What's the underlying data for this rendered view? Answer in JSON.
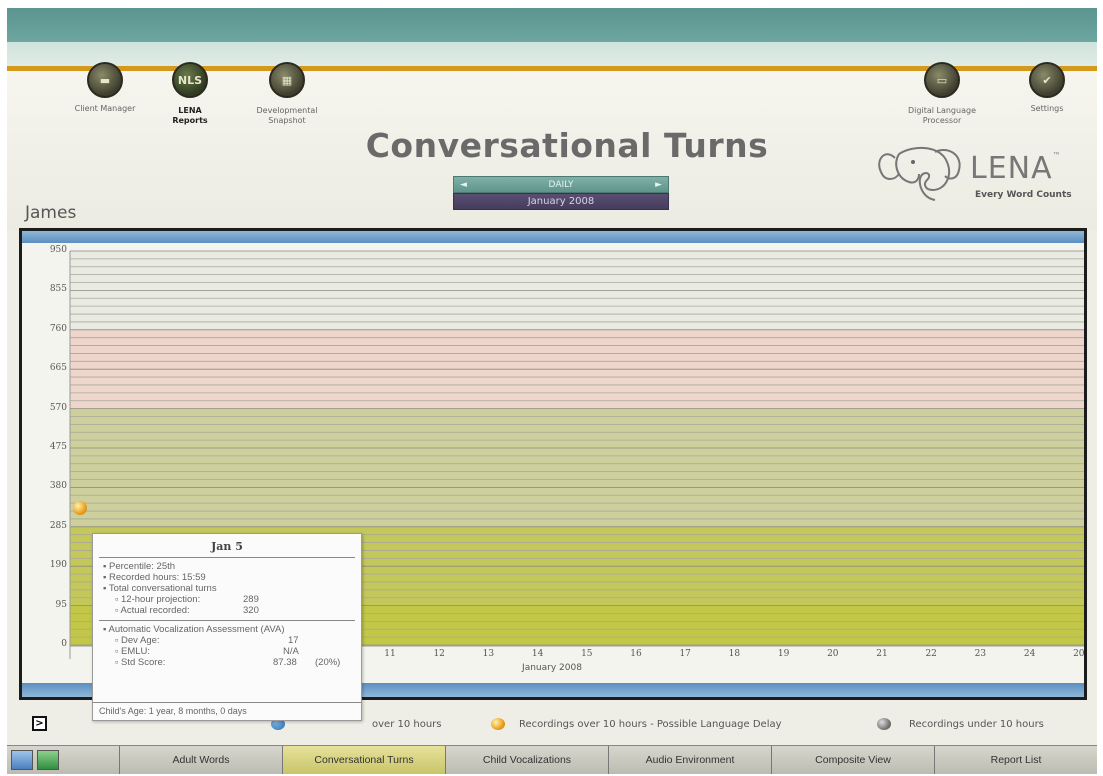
{
  "nav": {
    "left": [
      {
        "label": "Client Manager"
      },
      {
        "label": "LENA Reports"
      },
      {
        "label": "Developmental Snapshot"
      }
    ],
    "right": [
      {
        "label": "Digital Language Processor"
      },
      {
        "label": "Settings"
      }
    ]
  },
  "header": {
    "title": "Conversational Turns",
    "child_name": "James",
    "period_mode": "DAILY",
    "period_prev": "◄",
    "period_next": "►",
    "period_value": "January 2008",
    "logo_text": "LENA",
    "logo_tm": "™",
    "tagline": "Every Word Counts"
  },
  "chart_data": {
    "type": "scatter",
    "y_ticks": [
      "950",
      "855",
      "760",
      "665",
      "570",
      "475",
      "380",
      "285",
      "190",
      "95",
      "0"
    ],
    "ylim": [
      0,
      950
    ],
    "x_ticks": [
      "11",
      "12",
      "13",
      "14",
      "15",
      "16",
      "17",
      "18",
      "19",
      "20",
      "21",
      "22",
      "23",
      "24",
      "20"
    ],
    "xlabel": "January 2008",
    "points": [
      {
        "x": 5,
        "y": 320
      }
    ],
    "bands_color": {
      "top": "#e9ebe2",
      "upper_mid": "#efd6cc",
      "middle": "#cdcf9c",
      "lower": "#c4c85a"
    }
  },
  "tooltip": {
    "title": "Jan 5",
    "percentile": "Percentile: 25th",
    "recorded_hours": "Recorded hours: 15:59",
    "total_turns": "Total conversational turns",
    "projection_label": "12-hour projection:",
    "projection_value": "289",
    "actual_label": "Actual recorded:",
    "actual_value": "320",
    "ava_label": "Automatic Vocalization Assessment (AVA)",
    "dev_age_label": "Dev Age:",
    "dev_age_value": "17",
    "emlu_label": "EMLU:",
    "emlu_value": "N/A",
    "std_label": "Std Score:",
    "std_value": "87.38",
    "std_pct": "(20%)",
    "footer": "Child's Age: 1 year, 8 months, 0 days"
  },
  "legend": {
    "expand": ">",
    "item1": "over 10 hours",
    "item2": "Recordings over 10 hours - Possible Language Delay",
    "item3": "Recordings under 10 hours"
  },
  "tabs": [
    {
      "label": "Adult Words"
    },
    {
      "label": "Conversational Turns"
    },
    {
      "label": "Child Vocalizations"
    },
    {
      "label": "Audio Environment"
    },
    {
      "label": "Composite View"
    },
    {
      "label": "Report List"
    }
  ]
}
